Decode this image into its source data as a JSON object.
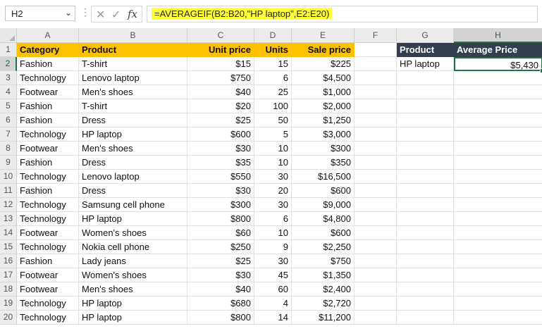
{
  "formula_bar": {
    "name_box": "H2",
    "formula": "=AVERAGEIF(B2:B20,\"HP laptop\",E2:E20)",
    "icons": [
      "cancel-x-icon",
      "enter-check-icon",
      "insert-function-fx-icon"
    ]
  },
  "columns": [
    "A",
    "B",
    "C",
    "D",
    "E",
    "F",
    "G",
    "H"
  ],
  "rows": [
    "1",
    "2",
    "3",
    "4",
    "5",
    "6",
    "7",
    "8",
    "9",
    "10",
    "11",
    "12",
    "13",
    "14",
    "15",
    "16",
    "17",
    "18",
    "19",
    "20"
  ],
  "table": {
    "headers": [
      "Category",
      "Product",
      "Unit price",
      "Units",
      "Sale price"
    ],
    "rows": [
      [
        "Fashion",
        "T-shirt",
        "$15",
        "15",
        "$225"
      ],
      [
        "Technology",
        "Lenovo laptop",
        "$750",
        "6",
        "$4,500"
      ],
      [
        "Footwear",
        "Men's shoes",
        "$40",
        "25",
        "$1,000"
      ],
      [
        "Fashion",
        "T-shirt",
        "$20",
        "100",
        "$2,000"
      ],
      [
        "Fashion",
        "Dress",
        "$25",
        "50",
        "$1,250"
      ],
      [
        "Technology",
        "HP laptop",
        "$600",
        "5",
        "$3,000"
      ],
      [
        "Footwear",
        "Men's shoes",
        "$30",
        "10",
        "$300"
      ],
      [
        "Fashion",
        "Dress",
        "$35",
        "10",
        "$350"
      ],
      [
        "Technology",
        "Lenovo laptop",
        "$550",
        "30",
        "$16,500"
      ],
      [
        "Fashion",
        "Dress",
        "$30",
        "20",
        "$600"
      ],
      [
        "Technology",
        "Samsung cell phone",
        "$300",
        "30",
        "$9,000"
      ],
      [
        "Technology",
        "HP laptop",
        "$800",
        "6",
        "$4,800"
      ],
      [
        "Footwear",
        "Women's shoes",
        "$60",
        "10",
        "$600"
      ],
      [
        "Technology",
        "Nokia cell phone",
        "$250",
        "9",
        "$2,250"
      ],
      [
        "Fashion",
        "Lady jeans",
        "$25",
        "30",
        "$750"
      ],
      [
        "Footwear",
        "Women's shoes",
        "$30",
        "45",
        "$1,350"
      ],
      [
        "Footwear",
        "Men's shoes",
        "$40",
        "60",
        "$2,400"
      ],
      [
        "Technology",
        "HP laptop",
        "$680",
        "4",
        "$2,720"
      ],
      [
        "Technology",
        "HP laptop",
        "$800",
        "14",
        "$11,200"
      ]
    ]
  },
  "summary": {
    "headers": [
      "Product",
      "Average Price"
    ],
    "product": "HP laptop",
    "average": "$5,430"
  },
  "colors": {
    "header_orange": "#ffc000",
    "header_dark": "#333f4f",
    "selection_green": "#217346",
    "formula_highlight": "#ffff3c"
  }
}
